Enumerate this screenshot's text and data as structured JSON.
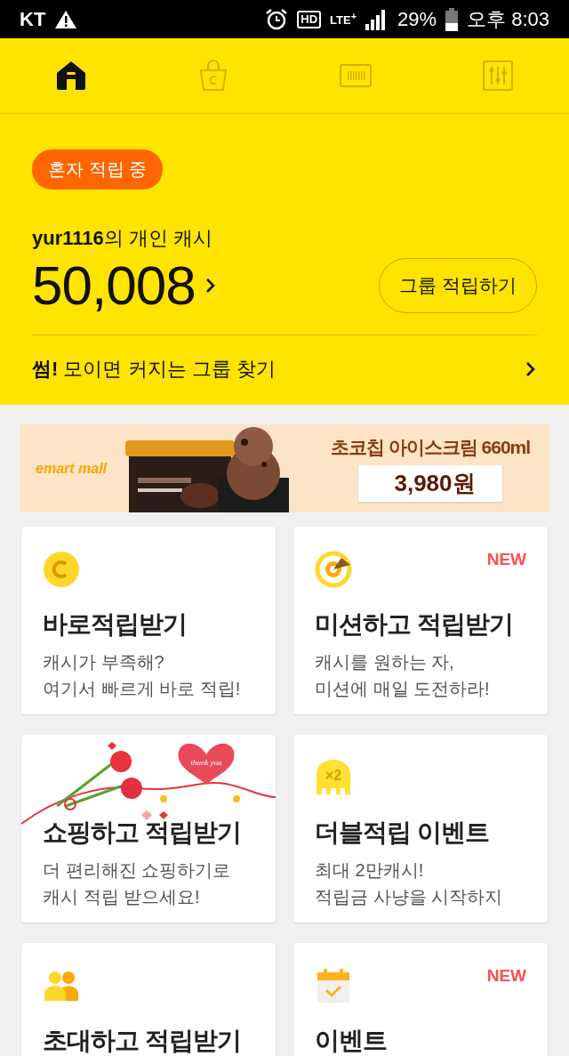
{
  "status_bar": {
    "carrier": "KT",
    "hd": "HD",
    "network": "LTE$^{+}$",
    "battery": "29%",
    "time": "오후 8:03"
  },
  "nav_tabs": [
    {
      "kind": "home",
      "selected": true
    },
    {
      "kind": "bag",
      "selected": false
    },
    {
      "kind": "barcode",
      "selected": false
    },
    {
      "kind": "sliders",
      "selected": false
    }
  ],
  "header": {
    "badge": "혼자 적립 중",
    "owner": "**yur1116**의 개인 캐시",
    "amount": "50,008",
    "group_button": "그룹 적립하기",
    "find_group": "**썸!** 모이면 커지는 그룹 찾기"
  },
  "banner": {
    "logo": "emart mall",
    "title": "초코칩 아이스크림 660ml",
    "price": "3,980원"
  },
  "cards": [
    {
      "kind": "coin",
      "title": "바로적립받기",
      "lines": [
        "캐시가 부족해?",
        "여기서 빠르게 바로 적립!"
      ]
    },
    {
      "kind": "target",
      "title": "미션하고 적립받기",
      "lines": [
        "캐시를 원하는 자,",
        "미션에 매일 도전하라!"
      ],
      "badge": "NEW"
    },
    {
      "kind": "flowers",
      "art_text": "thank you",
      "title": "쇼핑하고 적립받기",
      "lines": [
        "더 편리해진 쇼핑하기로",
        "캐시 적립 받으세요!"
      ]
    },
    {
      "kind": "double",
      "icon_text": "×2",
      "title": "더블적립 이벤트",
      "lines": [
        "최대 2만캐시!",
        "적립금 사냥을 시작하지"
      ]
    },
    {
      "kind": "people",
      "title": "초대하고 적립받기"
    },
    {
      "kind": "calendar",
      "title": "이벤트",
      "badge": "NEW"
    }
  ]
}
